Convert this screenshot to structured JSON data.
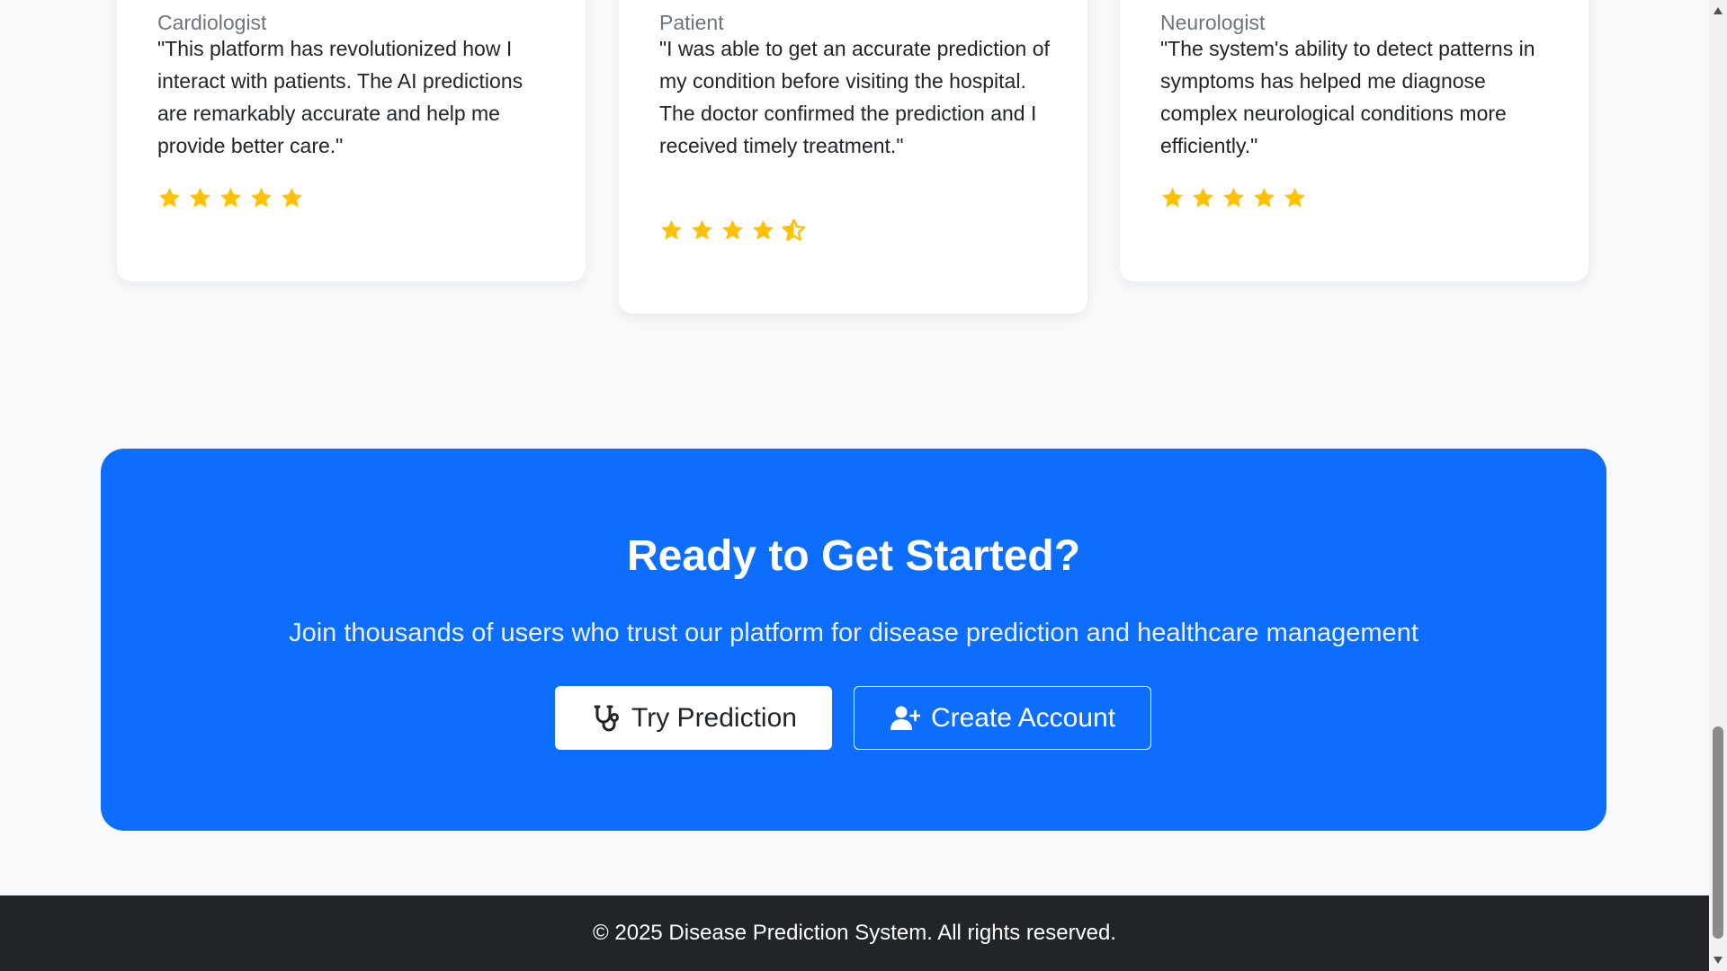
{
  "testimonials": [
    {
      "role": "Cardiologist",
      "quote": "\"This platform has revolutionized how I interact with patients. The AI predictions are remarkably accurate and help me provide better care.\"",
      "rating": 5
    },
    {
      "role": "Patient",
      "quote": "\"I was able to get an accurate prediction of my condition before visiting the hospital. The doctor confirmed the prediction and I received timely treatment.\"",
      "rating": 4.5
    },
    {
      "role": "Neurologist",
      "quote": "\"The system's ability to detect patterns in symptoms has helped me diagnose complex neurological conditions more efficiently.\"",
      "rating": 5
    }
  ],
  "cta": {
    "title": "Ready to Get Started?",
    "subtitle": "Join thousands of users who trust our platform for disease prediction and healthcare management",
    "try_label": "Try Prediction",
    "try_icon": "stethoscope-icon",
    "create_label": "Create Account",
    "create_icon": "user-plus-icon",
    "background_color": "#0d6efd"
  },
  "footer": {
    "text": "© 2025 Disease Prediction System. All rights reserved."
  },
  "colors": {
    "star": "#ffc107",
    "footer_bg": "#212529",
    "page_bg": "#f8f9fa"
  }
}
